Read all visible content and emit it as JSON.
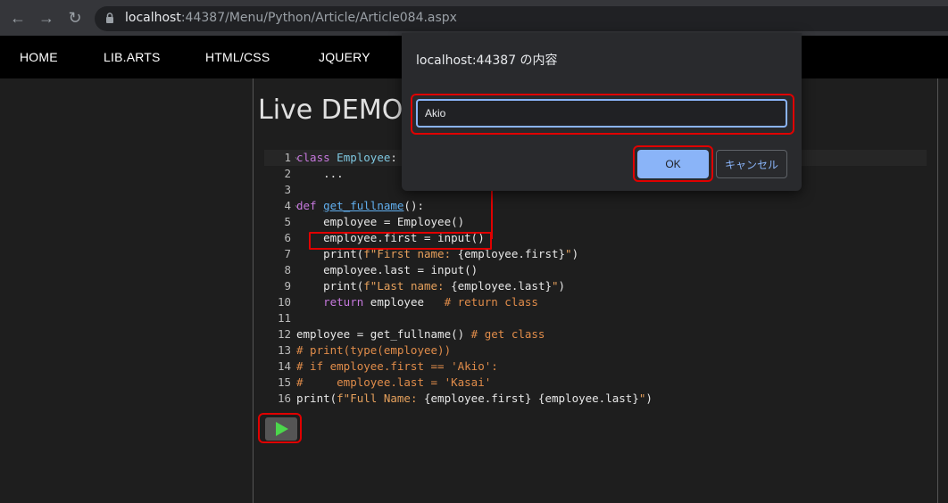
{
  "browser": {
    "url_host": "localhost",
    "url_rest": ":44387/Menu/Python/Article/Article084.aspx"
  },
  "nav": {
    "items": [
      "HOME",
      "LIB.ARTS",
      "HTML/CSS",
      "JQUERY"
    ]
  },
  "page": {
    "title": "Live DEMO"
  },
  "editor": {
    "line_numbers": [
      "1",
      "2",
      "3",
      "4",
      "5",
      "6",
      "7",
      "8",
      "9",
      "10",
      "11",
      "12",
      "13",
      "14",
      "15",
      "16"
    ],
    "lines": {
      "l1a": "class",
      "l1b": " ",
      "l1c": "Employee",
      "l1d": ":",
      "l2": "    ...",
      "l4a": "def",
      "l4b": " ",
      "l4c": "get_fullname",
      "l4d": "():",
      "l5": "    employee = Employee()",
      "l6": "    employee.first = input()",
      "l7a": "    print(",
      "l7b": "f\"First name: ",
      "l7c": "{employee.first}",
      "l7d": "\"",
      "l7e": ")",
      "l8": "    employee.last = input()",
      "l9a": "    print(",
      "l9b": "f\"Last name: ",
      "l9c": "{employee.last}",
      "l9d": "\"",
      "l9e": ")",
      "l10a": "    ",
      "l10b": "return",
      "l10c": " employee   ",
      "l10d": "# return class",
      "l12a": "employee = get_fullname() ",
      "l12b": "# get class",
      "l13": "# print(type(employee))",
      "l14": "# if employee.first == 'Akio':",
      "l15": "#     employee.last = 'Kasai'",
      "l16a": "print(",
      "l16b": "f\"Full Name: ",
      "l16c": "{employee.first} {employee.last}",
      "l16d": "\"",
      "l16e": ")"
    }
  },
  "dialog": {
    "title": "localhost:44387 の内容",
    "input_value": "Akio",
    "ok_label": "OK",
    "cancel_label": "キャンセル"
  },
  "colors": {
    "annotation": "#e00000",
    "accent": "#8ab4f8"
  }
}
